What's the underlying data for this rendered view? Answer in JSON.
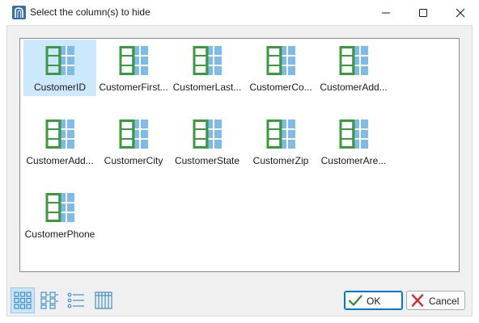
{
  "window": {
    "title": "Select the column(s) to hide",
    "app_icon": "app-logo-icon",
    "controls": [
      "minimize-icon",
      "maximize-icon",
      "close-icon"
    ]
  },
  "columns": [
    {
      "label": "CustomerID",
      "selected": true
    },
    {
      "label": "CustomerFirst...",
      "selected": false
    },
    {
      "label": "CustomerLast...",
      "selected": false
    },
    {
      "label": "CustomerCo...",
      "selected": false
    },
    {
      "label": "CustomerAdd...",
      "selected": false
    },
    {
      "label": "CustomerAdd...",
      "selected": false
    },
    {
      "label": "CustomerCity",
      "selected": false
    },
    {
      "label": "CustomerState",
      "selected": false
    },
    {
      "label": "CustomerZip",
      "selected": false
    },
    {
      "label": "CustomerAre...",
      "selected": false
    },
    {
      "label": "CustomerPhone",
      "selected": false
    }
  ],
  "column_icon": "table-column-icon",
  "view_modes": [
    {
      "icon": "large-icons-view-icon",
      "active": true
    },
    {
      "icon": "tiles-view-icon",
      "active": false
    },
    {
      "icon": "list-view-icon",
      "active": false
    },
    {
      "icon": "details-view-icon",
      "active": false
    }
  ],
  "buttons": {
    "ok_label": "OK",
    "cancel_label": "Cancel"
  },
  "colors": {
    "selection": "#cce8ff",
    "icon_green": "#3c9a3c",
    "icon_blue": "#7fbbe8",
    "accent": "#0078d4",
    "cancel_red": "#d42f2f"
  }
}
